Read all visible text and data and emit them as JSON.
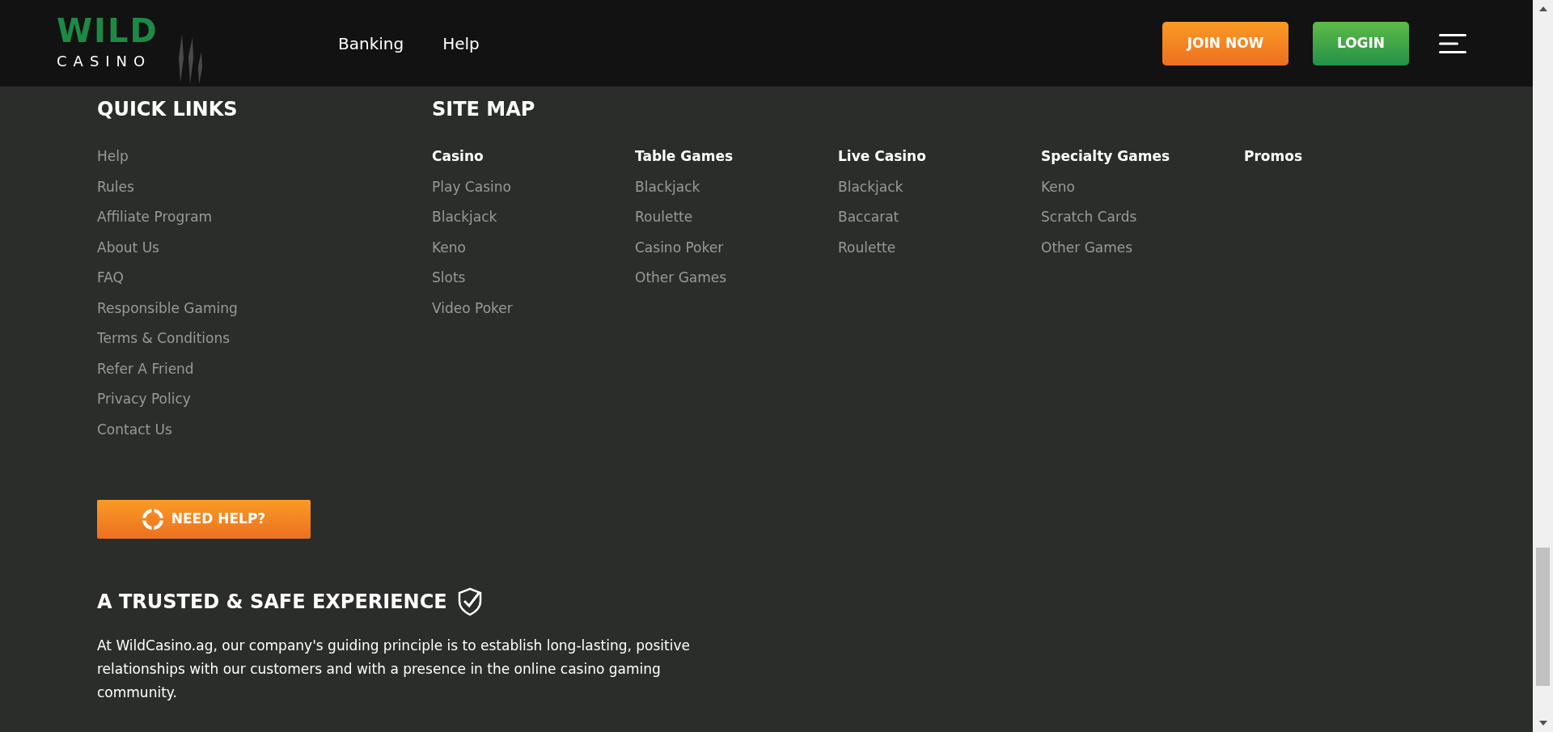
{
  "header": {
    "logo": {
      "top": "WILD",
      "bottom": "CASINO"
    },
    "nav": [
      "Banking",
      "Help"
    ],
    "join_button": "JOIN NOW",
    "login_button": "LOGIN"
  },
  "quick_links": {
    "title": "QUICK LINKS",
    "items": [
      "Help",
      "Rules",
      "Affiliate Program",
      "About Us",
      "FAQ",
      "Responsible Gaming",
      "Terms & Conditions",
      "Refer A Friend",
      "Privacy Policy",
      "Contact Us"
    ]
  },
  "site_map": {
    "title": "SITE MAP",
    "columns": [
      {
        "heading": "Casino",
        "items": [
          "Play Casino",
          "Blackjack",
          "Keno",
          "Slots",
          "Video Poker"
        ]
      },
      {
        "heading": "Table Games",
        "items": [
          "Blackjack",
          "Roulette",
          "Casino Poker",
          "Other Games"
        ]
      },
      {
        "heading": "Live Casino",
        "items": [
          "Blackjack",
          "Baccarat",
          "Roulette"
        ]
      },
      {
        "heading": "Specialty Games",
        "items": [
          "Keno",
          "Scratch Cards",
          "Other Games"
        ]
      },
      {
        "heading": "Promos"
      }
    ]
  },
  "need_help_button": "NEED HELP?",
  "trust": {
    "title": "A TRUSTED & SAFE EXPERIENCE",
    "text": "At WildCasino.ag, our company's guiding principle is to establish long-lasting, positive relationships with our customers and with a presence in the online casino gaming community."
  }
}
